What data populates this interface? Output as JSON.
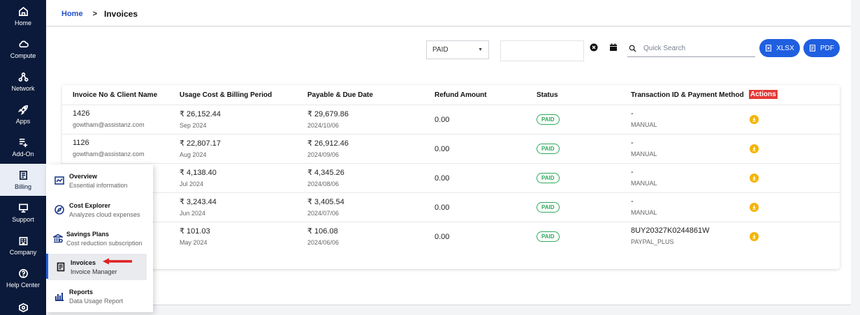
{
  "nav": {
    "items": [
      {
        "label": "Home",
        "icon": "home-icon"
      },
      {
        "label": "Compute",
        "icon": "cloud-icon"
      },
      {
        "label": "Network",
        "icon": "network-icon"
      },
      {
        "label": "Apps",
        "icon": "rocket-icon"
      },
      {
        "label": "Add-On",
        "icon": "list-add-icon"
      },
      {
        "label": "Billing",
        "icon": "receipt-icon"
      },
      {
        "label": "Support",
        "icon": "monitor-icon"
      },
      {
        "label": "Company",
        "icon": "building-icon"
      },
      {
        "label": "Help Center",
        "icon": "help-icon"
      },
      {
        "label": "",
        "icon": "settings-box-icon"
      }
    ],
    "active": "Billing"
  },
  "breadcrumb": {
    "home": "Home",
    "separator": ">",
    "current": "Invoices"
  },
  "toolbar": {
    "status_selected": "PAID",
    "search_placeholder": "Quick Search",
    "xlsx_label": "XLSX",
    "pdf_label": "PDF"
  },
  "table": {
    "columns": [
      "Invoice No & Client Name",
      "Usage Cost & Billing Period",
      "Payable & Due Date",
      "Refund Amount",
      "Status",
      "Transaction ID & Payment Method",
      "Actions"
    ],
    "rows": [
      {
        "invoice": "1426",
        "client": "gowtham@assistanz.com",
        "usage": "₹ 26,152.44",
        "period": "Sep 2024",
        "payable": "₹ 29,679.86",
        "due": "2024/10/06",
        "refund": "0.00",
        "status": "PAID",
        "txn": "-",
        "method": "MANUAL"
      },
      {
        "invoice": "1126",
        "client": "gowtham@assistanz.com",
        "usage": "₹ 22,807.17",
        "period": "Aug 2024",
        "payable": "₹ 26,912.46",
        "due": "2024/09/06",
        "refund": "0.00",
        "status": "PAID",
        "txn": "-",
        "method": "MANUAL"
      },
      {
        "invoice": "",
        "client": "",
        "usage": "₹ 4,138.40",
        "period": "Jul 2024",
        "payable": "₹ 4,345.26",
        "due": "2024/08/06",
        "refund": "0.00",
        "status": "PAID",
        "txn": "-",
        "method": "MANUAL"
      },
      {
        "invoice": "",
        "client": "",
        "usage": "₹ 3,243.44",
        "period": "Jun 2024",
        "payable": "₹ 3,405.54",
        "due": "2024/07/06",
        "refund": "0.00",
        "status": "PAID",
        "txn": "-",
        "method": "MANUAL"
      },
      {
        "invoice": "",
        "client": "",
        "usage": "₹ 101.03",
        "period": "May 2024",
        "payable": "₹ 106.08",
        "due": "2024/06/06",
        "refund": "0.00",
        "status": "PAID",
        "txn": "8UY20327K0244861W",
        "method": "PAYPAL_PLUS"
      }
    ]
  },
  "billing_menu": {
    "items": [
      {
        "title": "Overview",
        "subtitle": "Essential information",
        "icon": "chart-icon"
      },
      {
        "title": "Cost Explorer",
        "subtitle": "Analyzes cloud expenses",
        "icon": "compass-icon"
      },
      {
        "title": "Savings Plans",
        "subtitle": "Cost reduction subscription",
        "icon": "bank-icon"
      },
      {
        "title": "Invoices",
        "subtitle": "Invoice Manager",
        "icon": "receipt-icon"
      },
      {
        "title": "Reports",
        "subtitle": "Data Usage Report",
        "icon": "bar-chart-icon"
      }
    ],
    "active": "Invoices"
  },
  "colors": {
    "accent": "#1f5fe0",
    "rail": "#0b1a3a",
    "paid": "#2eaa5a",
    "download": "#f4b400",
    "actions_highlight": "#e53935",
    "pointer_arrow": "#e02020"
  }
}
